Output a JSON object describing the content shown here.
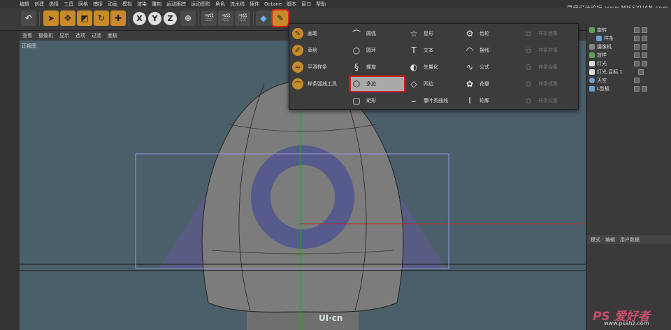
{
  "menu": [
    "编辑",
    "创建",
    "选择",
    "工具",
    "网格",
    "捕捉",
    "动画",
    "模拟",
    "渲染",
    "雕刻",
    "运动跟踪",
    "运动图形",
    "角色",
    "流水线",
    "插件",
    "Octane",
    "脚本",
    "窗口",
    "帮助"
  ],
  "watermark_top": "思缘设计论坛 www.MISSYUAN.com",
  "toolbar": {
    "axis_x": "X",
    "axis_y": "Y",
    "axis_z": "Z"
  },
  "viewport_menu": [
    "查看",
    "摄像机",
    "显示",
    "选项",
    "过滤",
    "面板"
  ],
  "viewport_label": "正视图",
  "spline_menu": {
    "col1": [
      "画笔",
      "草绘",
      "平滑样条",
      "样条弧线工具"
    ],
    "col2": [
      "圆弧",
      "圆环",
      "螺旋",
      "多边",
      "矩形"
    ],
    "col3": [
      "星形",
      "文本",
      "矢量化",
      "四边",
      "蔓叶类曲线"
    ],
    "col4": [
      "齿轮",
      "摆线",
      "公式",
      "花瓣",
      "轮廓"
    ],
    "col5": [
      "样条差集",
      "样条并集",
      "样条合集",
      "样条或集",
      "样条交集"
    ],
    "highlighted": "多边"
  },
  "objects": [
    {
      "name": "旋转",
      "indent": 0
    },
    {
      "name": "样条",
      "indent": 1
    },
    {
      "name": "摄像机",
      "indent": 0
    },
    {
      "name": "放样",
      "indent": 0
    },
    {
      "name": "灯光",
      "indent": 0
    },
    {
      "name": "灯光.目标.1",
      "indent": 0
    },
    {
      "name": "天空",
      "indent": 0
    },
    {
      "name": "L型板",
      "indent": 0
    }
  ],
  "attributes_bar": [
    "模式",
    "编辑",
    "用户数据"
  ],
  "watermark_bottom": "UI·cn",
  "watermark_ps": "PS 爱好者",
  "watermark_ps_url": "www.psahz.com",
  "colors": {
    "viewport_bg": "#4b5f6a",
    "menu_bg": "#3c3c3c",
    "highlight_border": "#d42020",
    "shape_gray": "#7c7c7c",
    "torus_purple": "#565a8c"
  }
}
